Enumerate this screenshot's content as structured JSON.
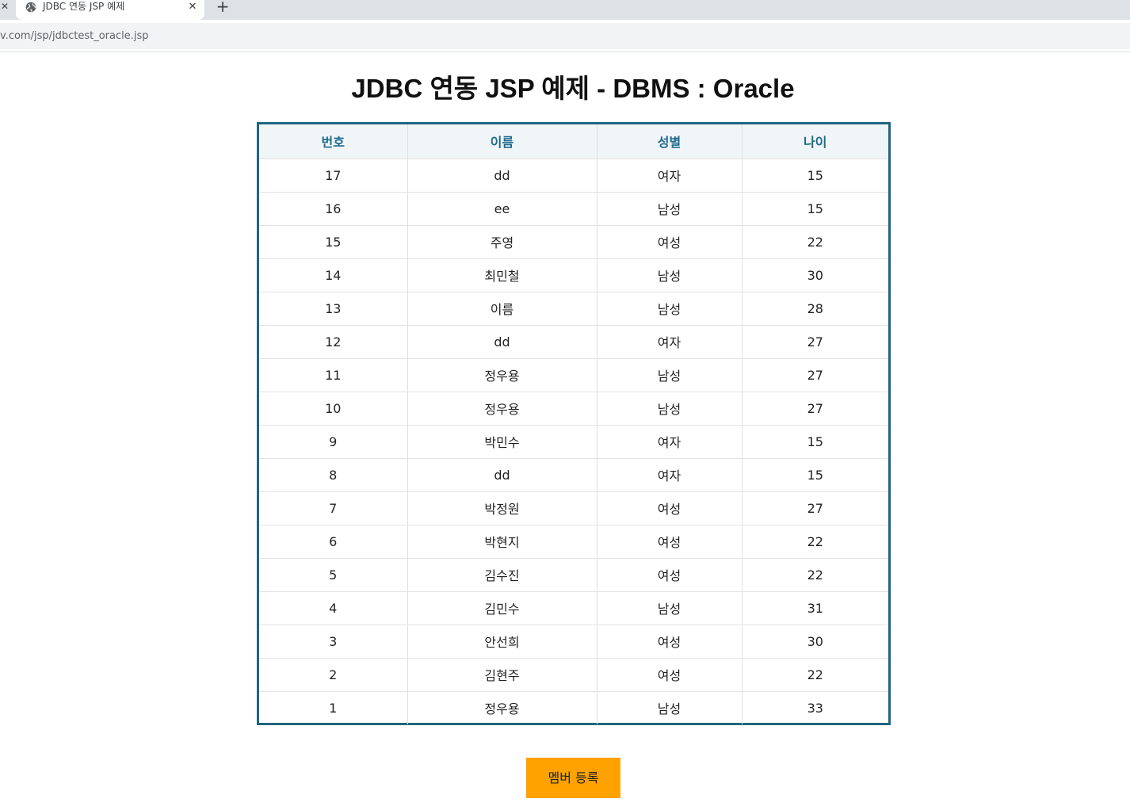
{
  "browser": {
    "prev_tab_close": "✕",
    "tab": {
      "title": "JDBC 연동 JSP 예제",
      "close": "✕",
      "icon": "globe-icon"
    },
    "new_tab": "+",
    "url": "v.com/jsp/jdbctest_oracle.jsp"
  },
  "page": {
    "title": "JDBC 연동 JSP 예제 - DBMS : Oracle"
  },
  "table": {
    "columns": [
      "번호",
      "이름",
      "성별",
      "나이"
    ],
    "rows": [
      [
        "17",
        "dd",
        "여자",
        "15"
      ],
      [
        "16",
        "ee",
        "남성",
        "15"
      ],
      [
        "15",
        "주영",
        "여성",
        "22"
      ],
      [
        "14",
        "최민철",
        "남성",
        "30"
      ],
      [
        "13",
        "이름",
        "남성",
        "28"
      ],
      [
        "12",
        "dd",
        "여자",
        "27"
      ],
      [
        "11",
        "정우용",
        "남성",
        "27"
      ],
      [
        "10",
        "정우용",
        "남성",
        "27"
      ],
      [
        "9",
        "박민수",
        "여자",
        "15"
      ],
      [
        "8",
        "dd",
        "여자",
        "15"
      ],
      [
        "7",
        "박정원",
        "여성",
        "27"
      ],
      [
        "6",
        "박현지",
        "여성",
        "22"
      ],
      [
        "5",
        "김수진",
        "여성",
        "22"
      ],
      [
        "4",
        "김민수",
        "남성",
        "31"
      ],
      [
        "3",
        "안선희",
        "여성",
        "30"
      ],
      [
        "2",
        "김현주",
        "여성",
        "22"
      ],
      [
        "1",
        "정우용",
        "남성",
        "33"
      ]
    ]
  },
  "register_button": {
    "label": "멤버 등록"
  },
  "colors": {
    "table_border": "#1f6580",
    "header_text": "#1d6a8e",
    "header_bg": "#f0f5f8",
    "button_bg": "#ffa200"
  }
}
